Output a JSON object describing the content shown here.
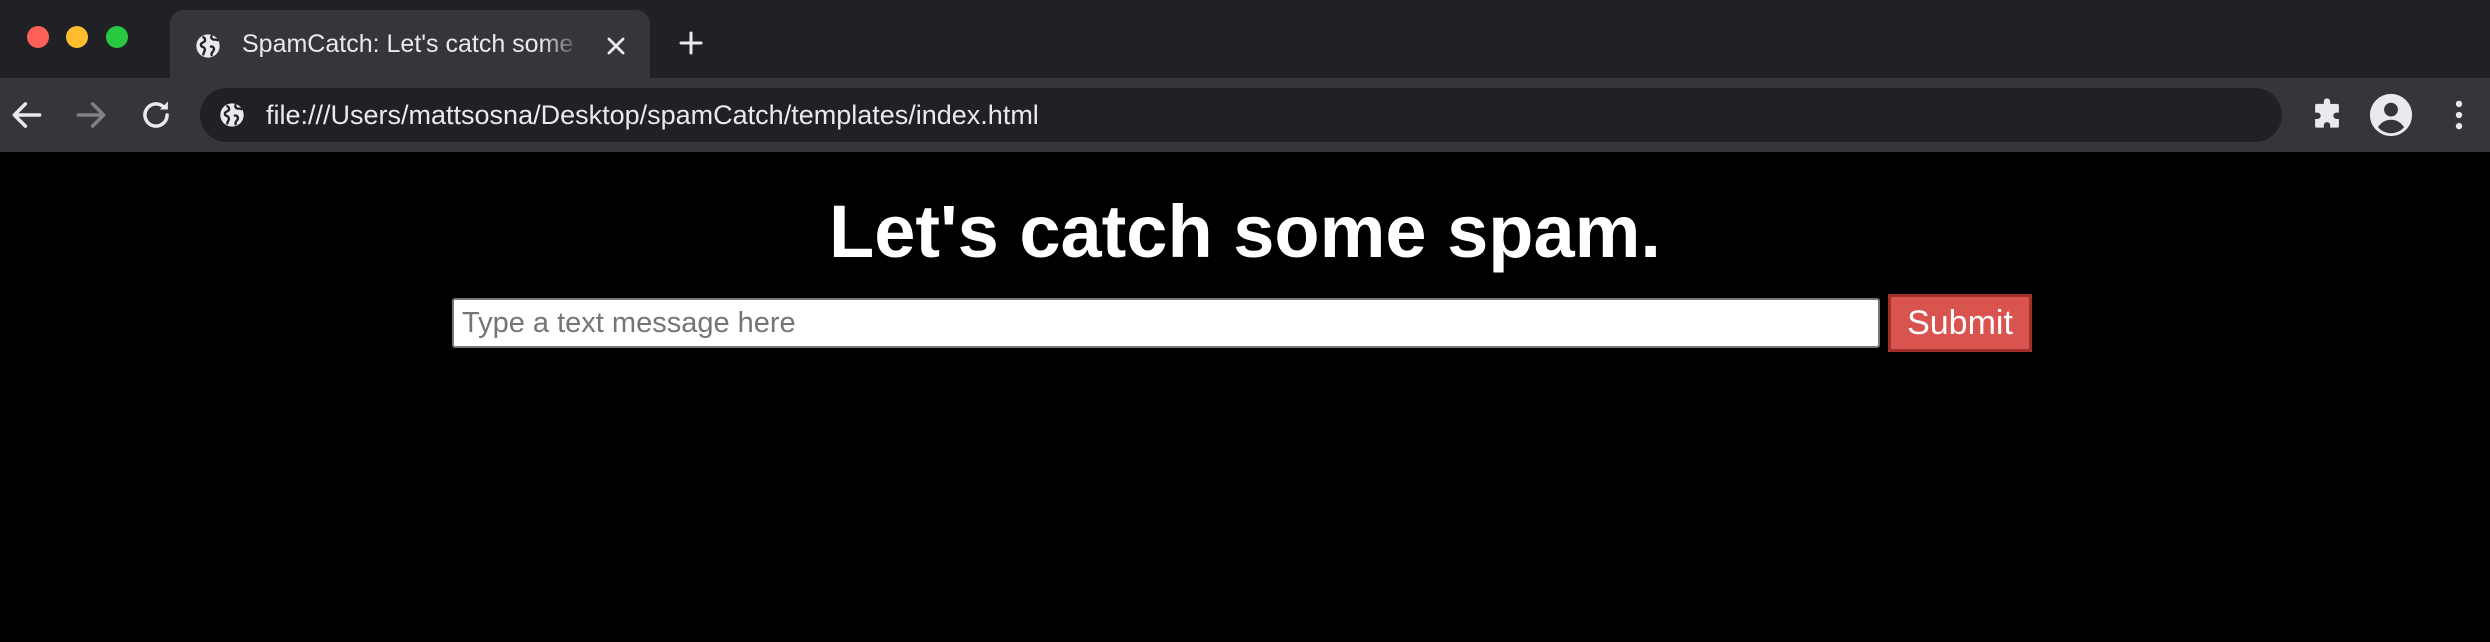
{
  "browser": {
    "tab": {
      "title": "SpamCatch: Let's catch some spam.",
      "favicon": "globe-icon"
    },
    "address_bar": {
      "url": "file:///Users/mattsosna/Desktop/spamCatch/templates/index.html",
      "site_icon": "globe-icon"
    },
    "icons": {
      "back": "arrow-left-icon",
      "forward": "arrow-right-icon",
      "reload": "reload-icon",
      "new_tab": "plus-icon",
      "close_tab": "close-icon",
      "extensions": "puzzle-icon",
      "profile": "account-circle-icon",
      "menu": "kebab-menu-icon"
    },
    "colors": {
      "tab_strip": "#202124",
      "toolbar": "#35363a",
      "omnibox": "#202124"
    }
  },
  "page": {
    "heading": "Let's catch some spam.",
    "form": {
      "placeholder": "Type a text message here",
      "value": "",
      "submit_label": "Submit"
    },
    "colors": {
      "background": "#000000",
      "heading": "#ffffff",
      "submit_bg": "#d9534f",
      "submit_border": "#a32f2b"
    }
  }
}
